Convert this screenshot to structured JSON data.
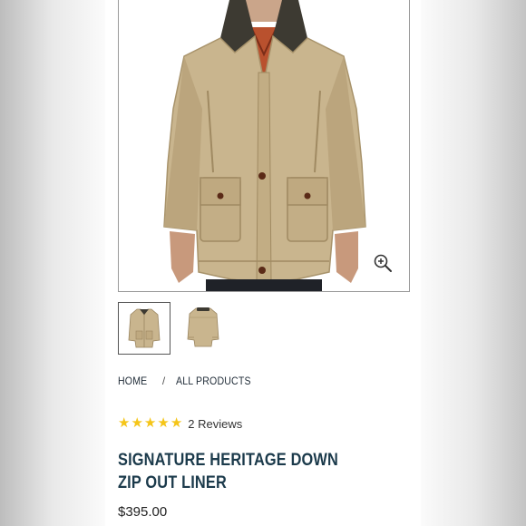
{
  "product": {
    "title": "SIGNATURE HERITAGE DOWN ZIP OUT LINER",
    "price": "$395.00",
    "rating": 5,
    "reviews_label": "2 Reviews"
  },
  "breadcrumb": {
    "items": [
      "HOME",
      "ALL PRODUCTS"
    ],
    "separator": "/"
  },
  "gallery": {
    "zoom_icon": "zoom-in-icon",
    "thumbnails": [
      "front-view",
      "back-view"
    ],
    "active_index": 0
  },
  "colors": {
    "jacket": "#c8b48c",
    "title": "#1b3a4b",
    "star": "#f5c518"
  }
}
